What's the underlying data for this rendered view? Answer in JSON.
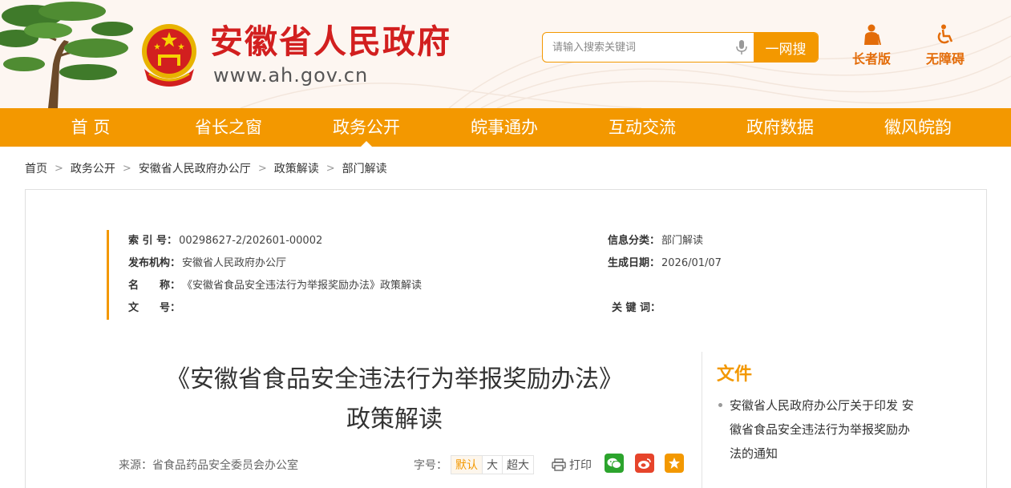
{
  "header": {
    "site_title": "安徽省人民政府",
    "site_url": "www.ah.gov.cn",
    "search_placeholder": "请输入搜索关键词",
    "search_button": "一网搜",
    "elder_label": "长者版",
    "accessible_label": "无障碍"
  },
  "nav": {
    "items": [
      "首 页",
      "省长之窗",
      "政务公开",
      "皖事通办",
      "互动交流",
      "政府数据",
      "徽风皖韵"
    ],
    "active_index": 2
  },
  "breadcrumb": {
    "items": [
      "首页",
      "政务公开",
      "安徽省人民政府办公厅",
      "政策解读",
      "部门解读"
    ],
    "separator": ">"
  },
  "meta": {
    "index_label": "索 引 号：",
    "index_value": "00298627-2/202601-00002",
    "category_label": "信息分类：",
    "category_value": "部门解读",
    "publisher_label": "发布机构：",
    "publisher_value": "安徽省人民政府办公厅",
    "date_label": "生成日期：",
    "date_value": "2026/01/07",
    "name_label": "名　　称：",
    "name_value": "《安徽省食品安全违法行为举报奖励办法》政策解读",
    "docno_label": "文　　号：",
    "docno_value": "",
    "keywords_label": "关 键 词：",
    "keywords_value": ""
  },
  "article": {
    "title_line1": "《安徽省食品安全违法行为举报奖励办法》",
    "title_line2": "政策解读",
    "source": "来源：省食品药品安全委员会办公室",
    "fontsize_label": "字号：",
    "fontsize_default": "默认",
    "fontsize_large": "大",
    "fontsize_xlarge": "超大",
    "print_label": "打印"
  },
  "sidebar": {
    "title": "文件",
    "items": [
      "安徽省人民政府办公厅关于印发 安徽省食品安全违法行为举报奖励办法的通知"
    ]
  },
  "colors": {
    "brand_orange": "#f39800",
    "title_red": "#d21f1f",
    "wechat_green": "#2ca42d",
    "weibo_red": "#e6442b"
  }
}
